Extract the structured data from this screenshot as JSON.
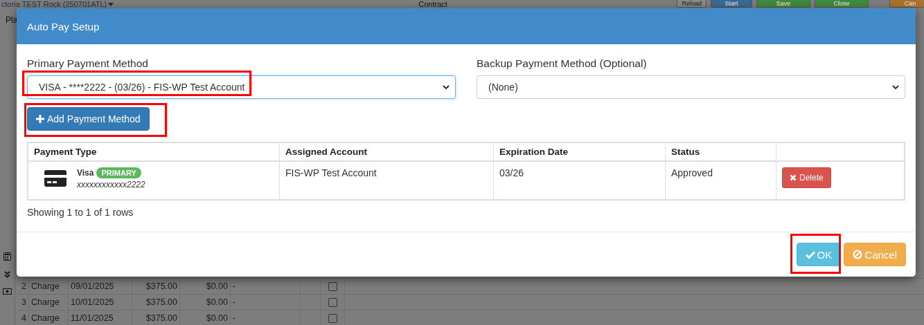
{
  "page": {
    "title": "ctoria TEST Rock (250701ATL)",
    "heading": "Contract",
    "tab": "Pla",
    "toolbar": [
      {
        "label": "Reload",
        "kind": "reload"
      },
      {
        "label": "Start",
        "kind": "start"
      },
      {
        "label": "Save",
        "kind": "save"
      },
      {
        "label": "Close",
        "kind": "close"
      },
      {
        "label": "Can",
        "kind": "cancel"
      }
    ],
    "rows": [
      {
        "number": "2",
        "type": "Charge",
        "date": "09/01/2025",
        "amount": "$375.00",
        "paid": "$0.00",
        "note": "-",
        "checked": false
      },
      {
        "number": "3",
        "type": "Charge",
        "date": "10/01/2025",
        "amount": "$375.00",
        "paid": "$0.00",
        "note": "-",
        "checked": false
      },
      {
        "number": "4",
        "type": "Charge",
        "date": "11/01/2025",
        "amount": "$375.00",
        "paid": "$0.00",
        "note": "-",
        "checked": false
      }
    ]
  },
  "dialog": {
    "title": "Auto Pay Setup",
    "primary": {
      "label": "Primary Payment Method",
      "value": "VISA - ****2222 - (03/26) - FIS-WP Test Account",
      "highlighted": true
    },
    "backup": {
      "label": "Backup Payment Method (Optional)",
      "value": "(None)"
    },
    "add_button": {
      "label": "Add Payment Method",
      "highlighted": true
    },
    "table": {
      "columns": [
        "Payment Type",
        "Assigned Account",
        "Expiration Date",
        "Status"
      ],
      "rows": [
        {
          "brand": "Visa",
          "badge": "PRIMARY",
          "number": "xxxxxxxxxxxx2222",
          "account": "FIS-WP Test Account",
          "expiration": "03/26",
          "status": "Approved",
          "action": "Delete"
        }
      ]
    },
    "footer_text": "Showing 1 to 1 of 1 rows",
    "buttons": [
      {
        "label": "OK",
        "kind": "ok",
        "highlighted": true
      },
      {
        "label": "Cancel",
        "kind": "cancel"
      }
    ]
  }
}
